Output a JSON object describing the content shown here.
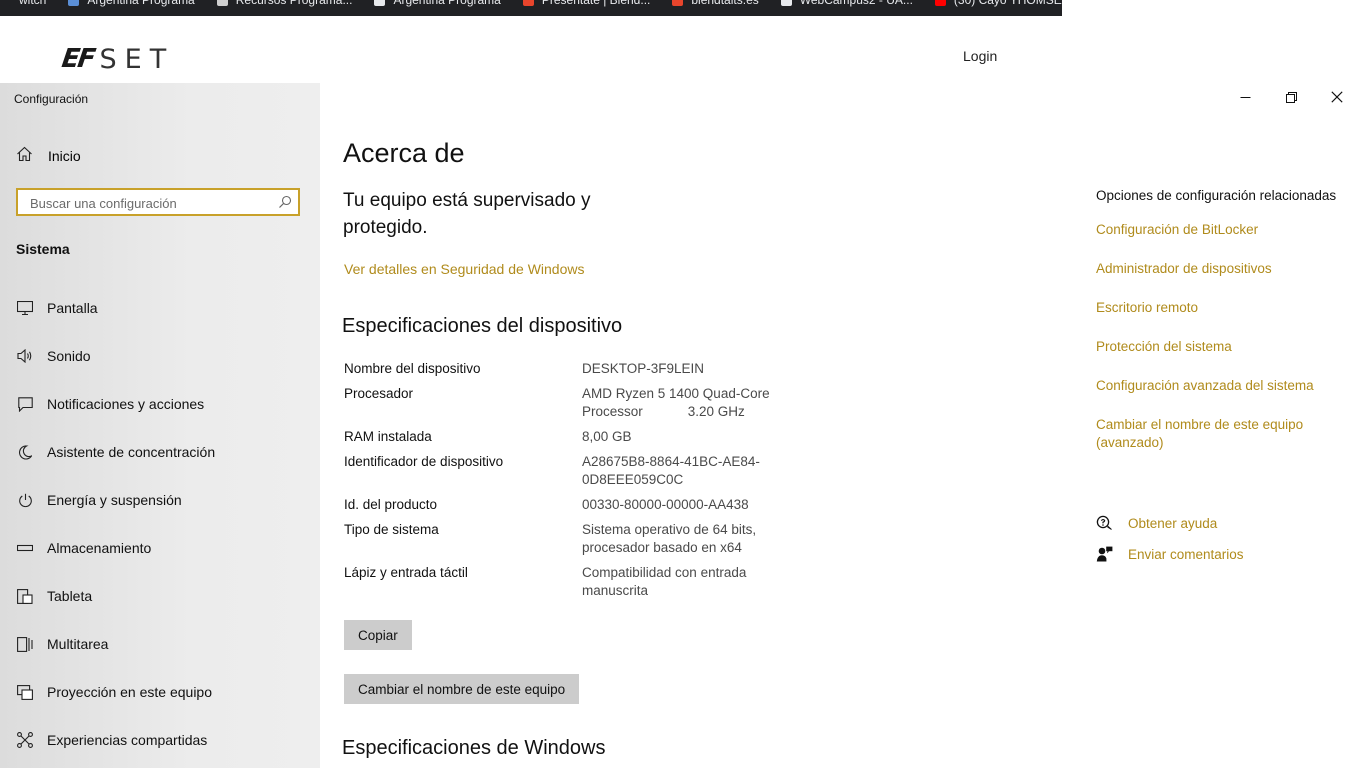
{
  "browser": {
    "bookmarks": [
      {
        "label": "witch",
        "color": "#202124"
      },
      {
        "label": "Argentina Programa",
        "color": "#5b8fd6"
      },
      {
        "label": "Recursos Programa...",
        "color": "#cfcfcf"
      },
      {
        "label": "Argentina Programa",
        "color": "#e8eaed"
      },
      {
        "label": "Presentate | Blend...",
        "color": "#e8452c"
      },
      {
        "label": "blendtalts.es",
        "color": "#e8452c"
      },
      {
        "label": "WebCampus2 - UA...",
        "color": "#e8eaed"
      },
      {
        "label": "(30) Cayo YHOMSE...",
        "color": "#ff0000"
      }
    ]
  },
  "website": {
    "logo_ef": "EF",
    "logo_set": "SET",
    "login_label": "Login"
  },
  "window": {
    "title": "Configuración",
    "controls": [
      "minimize-icon",
      "restore-icon",
      "close-icon"
    ]
  },
  "sidebar": {
    "home_label": "Inicio",
    "search_placeholder": "Buscar una configuración",
    "section_label": "Sistema",
    "items": [
      {
        "label": "Pantalla",
        "icon": "display-icon"
      },
      {
        "label": "Sonido",
        "icon": "sound-icon"
      },
      {
        "label": "Notificaciones y acciones",
        "icon": "notifications-icon"
      },
      {
        "label": "Asistente de concentración",
        "icon": "focus-assist-icon"
      },
      {
        "label": "Energía y suspensión",
        "icon": "power-icon"
      },
      {
        "label": "Almacenamiento",
        "icon": "storage-icon"
      },
      {
        "label": "Tableta",
        "icon": "tablet-icon"
      },
      {
        "label": "Multitarea",
        "icon": "multitasking-icon"
      },
      {
        "label": "Proyección en este equipo",
        "icon": "projection-icon"
      },
      {
        "label": "Experiencias compartidas",
        "icon": "shared-experiences-icon"
      }
    ]
  },
  "main": {
    "title": "Acerca de",
    "protection_text": "Tu equipo está supervisado y protegido.",
    "security_link": "Ver detalles en Seguridad de Windows",
    "device_specs_title": "Especificaciones del dispositivo",
    "device_specs": [
      {
        "key": "Nombre del dispositivo",
        "value": "DESKTOP-3F9LEIN"
      },
      {
        "key": "Procesador",
        "value": "AMD Ryzen 5 1400 Quad-Core Processor            3.20 GHz"
      },
      {
        "key": "RAM instalada",
        "value": "8,00 GB"
      },
      {
        "key": "Identificador de dispositivo",
        "value": "A28675B8-8864-41BC-AE84-0D8EEE059C0C"
      },
      {
        "key": "Id. del producto",
        "value": "00330-80000-00000-AA438"
      },
      {
        "key": "Tipo de sistema",
        "value": "Sistema operativo de 64 bits, procesador basado en x64"
      },
      {
        "key": "Lápiz y entrada táctil",
        "value": "Compatibilidad con entrada manuscrita"
      }
    ],
    "copy_button": "Copiar",
    "rename_button": "Cambiar el nombre de este equipo",
    "windows_specs_title": "Especificaciones de Windows"
  },
  "related": {
    "title": "Opciones de configuración relacionadas",
    "links": [
      "Configuración de BitLocker",
      "Administrador de dispositivos",
      "Escritorio remoto",
      "Protección del sistema",
      "Configuración avanzada del sistema",
      "Cambiar el nombre de este equipo (avanzado)"
    ],
    "help_label": "Obtener ayuda",
    "feedback_label": "Enviar comentarios"
  },
  "colors": {
    "accent": "#b08b1c",
    "search_border": "#c8a12a",
    "button_bg": "#cccccc"
  }
}
